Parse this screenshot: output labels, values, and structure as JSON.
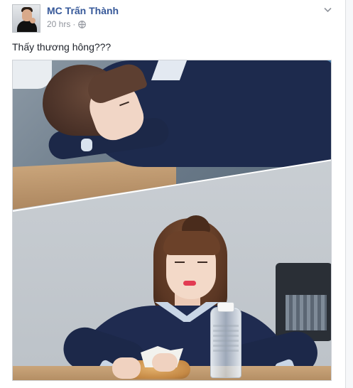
{
  "post": {
    "author": "MC Trấn Thành",
    "timestamp": "20 hrs",
    "separator": "·",
    "privacy_icon": "globe-icon",
    "menu_icon": "chevron-down-icon",
    "text": "Thấy thương hông???"
  },
  "colors": {
    "author_link": "#365899",
    "meta_text": "#90949c",
    "body_text": "#1d2129",
    "border": "#dddfe2"
  }
}
